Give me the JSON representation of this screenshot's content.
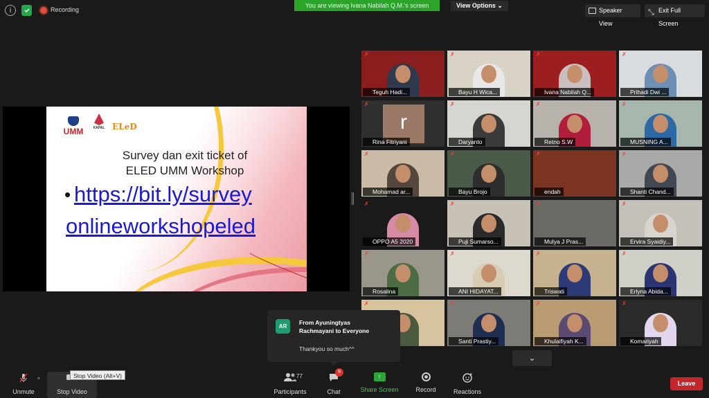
{
  "topbar": {
    "recording_label": "Recording",
    "viewing_banner": "You are viewing Ivana Nabilah Q.M.'s screen",
    "view_options_label": "View Options ⌄",
    "speaker_view_label": "Speaker View",
    "exit_full_screen_label": "Exit Full Screen"
  },
  "slide": {
    "logo_umm": "UMM",
    "logo_kapal": "KAPAL",
    "logo_eled": "ELeD",
    "title_line1": "Survey dan exit ticket of",
    "title_line2": "ELED UMM Workshop",
    "bullet": "•",
    "link_line1": "https://bit.ly/survey",
    "link_line2": "onlineworkshopeled"
  },
  "gallery": {
    "tiles": [
      {
        "name": "Teguh Hadi...",
        "bg": "#8a1e1e",
        "shirt": "#2f3a4e"
      },
      {
        "name": "Bayu H Wica...",
        "bg": "#d8d3c4",
        "shirt": "#e8e8e8"
      },
      {
        "name": "Ivana Nabilah Q...",
        "bg": "#9c1e1e",
        "shirt": "#c9bfc1"
      },
      {
        "name": "Prihadi Dwi ...",
        "bg": "#d9dde0",
        "shirt": "#6e8fb4"
      },
      {
        "name": "Rina Fitriyani",
        "bg": "#2f2f2f",
        "shirt": "#2f2f2f",
        "initial": "r"
      },
      {
        "name": "Daryanto",
        "bg": "#d6d5cf",
        "shirt": "#3b3b3b"
      },
      {
        "name": "Retno S.W",
        "bg": "#b7b2ab",
        "shirt": "#b01e3c"
      },
      {
        "name": "MUSNING A...",
        "bg": "#a6b7ae",
        "shirt": "#2c6aa5"
      },
      {
        "name": "Mohamad ar...",
        "bg": "#c9bba5",
        "shirt": "#54483e"
      },
      {
        "name": "Bayu Brojo",
        "bg": "#4a5a48",
        "shirt": "#2d2d2d"
      },
      {
        "name": "endah",
        "bg": "#7a3420",
        "shirt": "#7a3420"
      },
      {
        "name": "Shanti Chand...",
        "bg": "#a9a9a7",
        "shirt": "#424852"
      },
      {
        "name": "OPPO A5 2020",
        "bg": "#1a1a1a",
        "shirt": "#d58aa6"
      },
      {
        "name": "Puji Sumarso...",
        "bg": "#c8c2b6",
        "shirt": "#2a2a2a"
      },
      {
        "name": "Mulya J Pras...",
        "bg": "#6b6a65",
        "shirt": "#6b6a65"
      },
      {
        "name": "Ervira Syaidiy...",
        "bg": "#c3c1ba",
        "shirt": "#d9d4cd"
      },
      {
        "name": "Rosalina",
        "bg": "#9b968c",
        "shirt": "#4c6d44"
      },
      {
        "name": "ANI HIDAYAT...",
        "bg": "#ded9cf",
        "shirt": "#d8ccb5"
      },
      {
        "name": "Triswati",
        "bg": "#c6b28e",
        "shirt": "#2c3b78"
      },
      {
        "name": "Erlyna Abida...",
        "bg": "#cfd0c7",
        "shirt": "#2c3572"
      },
      {
        "name": "...o Pr...",
        "bg": "#d7c39d",
        "shirt": "#4b5a3f"
      },
      {
        "name": "Santi Prastiy...",
        "bg": "#7d7c77",
        "shirt": "#1e2f52"
      },
      {
        "name": "Khulaifiyah K...",
        "bg": "#b99b74",
        "shirt": "#5b4a72"
      },
      {
        "name": "Komariyah",
        "bg": "#2a2a2a",
        "shirt": "#e2d7ee"
      }
    ]
  },
  "chat_toast": {
    "avatar_initials": "AR",
    "from_line1": "From Ayuningtyas",
    "from_line2": "Rachmayani to Everyone",
    "message": "Thankyou so much^^"
  },
  "toolbar": {
    "unmute_label": "Unmute",
    "stop_video_label": "Stop Video",
    "stop_video_tooltip": "Stop Video (Alt+V)",
    "participants_label": "Participants",
    "participants_count": "77",
    "chat_label": "Chat",
    "chat_badge": "9",
    "share_label": "Share Screen",
    "record_label": "Record",
    "reactions_label": "Reactions",
    "leave_label": "Leave"
  }
}
